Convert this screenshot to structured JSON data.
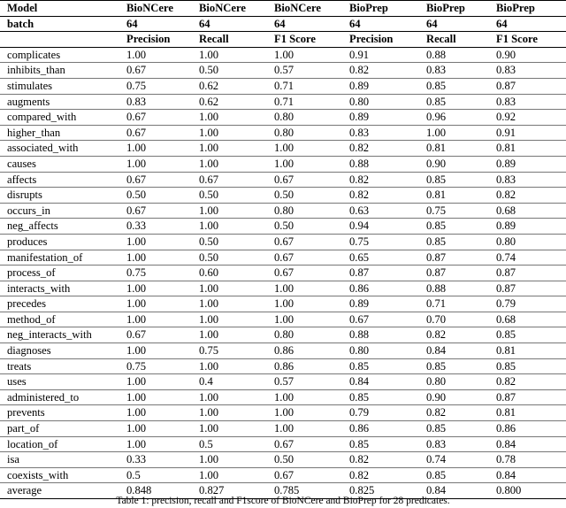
{
  "table": {
    "header_rows": [
      {
        "label": "Model",
        "values": [
          "BioNCere",
          "BioNCere",
          "BioNCere",
          "BioPrep",
          "BioPrep",
          "BioPrep"
        ]
      },
      {
        "label": "batch",
        "values": [
          "64",
          "64",
          "64",
          "64",
          "64",
          "64"
        ]
      },
      {
        "label": "",
        "values": [
          "Precision",
          "Recall",
          "F1 Score",
          "Precision",
          "Recall",
          "F1 Score"
        ]
      }
    ],
    "rows": [
      {
        "label": "complicates",
        "values": [
          "1.00",
          "1.00",
          "1.00",
          "0.91",
          "0.88",
          "0.90"
        ]
      },
      {
        "label": "inhibits_than",
        "values": [
          "0.67",
          "0.50",
          "0.57",
          "0.82",
          "0.83",
          "0.83"
        ]
      },
      {
        "label": "stimulates",
        "values": [
          "0.75",
          "0.62",
          "0.71",
          "0.89",
          "0.85",
          "0.87"
        ]
      },
      {
        "label": "augments",
        "values": [
          "0.83",
          "0.62",
          "0.71",
          "0.80",
          "0.85",
          "0.83"
        ]
      },
      {
        "label": "compared_with",
        "values": [
          "0.67",
          "1.00",
          "0.80",
          "0.89",
          "0.96",
          "0.92"
        ]
      },
      {
        "label": "higher_than",
        "values": [
          "0.67",
          "1.00",
          "0.80",
          "0.83",
          "1.00",
          "0.91"
        ]
      },
      {
        "label": "associated_with",
        "values": [
          "1.00",
          "1.00",
          "1.00",
          "0.82",
          "0.81",
          "0.81"
        ]
      },
      {
        "label": "causes",
        "values": [
          "1.00",
          "1.00",
          "1.00",
          "0.88",
          "0.90",
          "0.89"
        ]
      },
      {
        "label": "affects",
        "values": [
          "0.67",
          "0.67",
          "0.67",
          "0.82",
          "0.85",
          "0.83"
        ]
      },
      {
        "label": "disrupts",
        "values": [
          "0.50",
          "0.50",
          "0.50",
          "0.82",
          "0.81",
          "0.82"
        ]
      },
      {
        "label": "occurs_in",
        "values": [
          "0.67",
          "1.00",
          "0.80",
          "0.63",
          "0.75",
          "0.68"
        ]
      },
      {
        "label": "neg_affects",
        "values": [
          "0.33",
          "1.00",
          "0.50",
          "0.94",
          "0.85",
          "0.89"
        ]
      },
      {
        "label": "produces",
        "values": [
          "1.00",
          "0.50",
          "0.67",
          "0.75",
          "0.85",
          "0.80"
        ]
      },
      {
        "label": "manifestation_of",
        "values": [
          "1.00",
          "0.50",
          "0.67",
          "0.65",
          "0.87",
          "0.74"
        ]
      },
      {
        "label": "process_of",
        "values": [
          "0.75",
          "0.60",
          "0.67",
          "0.87",
          "0.87",
          "0.87"
        ]
      },
      {
        "label": "interacts_with",
        "values": [
          "1.00",
          "1.00",
          "1.00",
          "0.86",
          "0.88",
          "0.87"
        ]
      },
      {
        "label": "precedes",
        "values": [
          "1.00",
          "1.00",
          "1.00",
          "0.89",
          "0.71",
          "0.79"
        ]
      },
      {
        "label": "method_of",
        "values": [
          "1.00",
          "1.00",
          "1.00",
          "0.67",
          "0.70",
          "0.68"
        ]
      },
      {
        "label": "neg_interacts_with",
        "values": [
          "0.67",
          "1.00",
          "0.80",
          "0.88",
          "0.82",
          "0.85"
        ]
      },
      {
        "label": "diagnoses",
        "values": [
          "1.00",
          "0.75",
          "0.86",
          "0.80",
          "0.84",
          "0.81"
        ]
      },
      {
        "label": "treats",
        "values": [
          "0.75",
          "1.00",
          "0.86",
          "0.85",
          "0.85",
          "0.85"
        ]
      },
      {
        "label": "uses",
        "values": [
          "1.00",
          "0.4",
          "0.57",
          "0.84",
          "0.80",
          "0.82"
        ]
      },
      {
        "label": "administered_to",
        "values": [
          "1.00",
          "1.00",
          "1.00",
          "0.85",
          "0.90",
          "0.87"
        ]
      },
      {
        "label": "prevents",
        "values": [
          "1.00",
          "1.00",
          "1.00",
          "0.79",
          "0.82",
          "0.81"
        ]
      },
      {
        "label": "part_of",
        "values": [
          "1.00",
          "1.00",
          "1.00",
          "0.86",
          "0.85",
          "0.86"
        ]
      },
      {
        "label": "location_of",
        "values": [
          "1.00",
          "0.5",
          "0.67",
          "0.85",
          "0.83",
          "0.84"
        ]
      },
      {
        "label": "isa",
        "values": [
          "0.33",
          "1.00",
          "0.50",
          "0.82",
          "0.74",
          "0.78"
        ]
      },
      {
        "label": "coexists_with",
        "values": [
          "0.5",
          "1.00",
          "0.67",
          "0.82",
          "0.85",
          "0.84"
        ]
      }
    ],
    "summary_row": {
      "label": "average",
      "values": [
        "0.848",
        "0.827",
        "0.785",
        "0.825",
        "0.84",
        "0.800"
      ]
    }
  },
  "caption": "Table 1: precision, recall and F1score of BioNCere and BioPrep for 28 predicates."
}
